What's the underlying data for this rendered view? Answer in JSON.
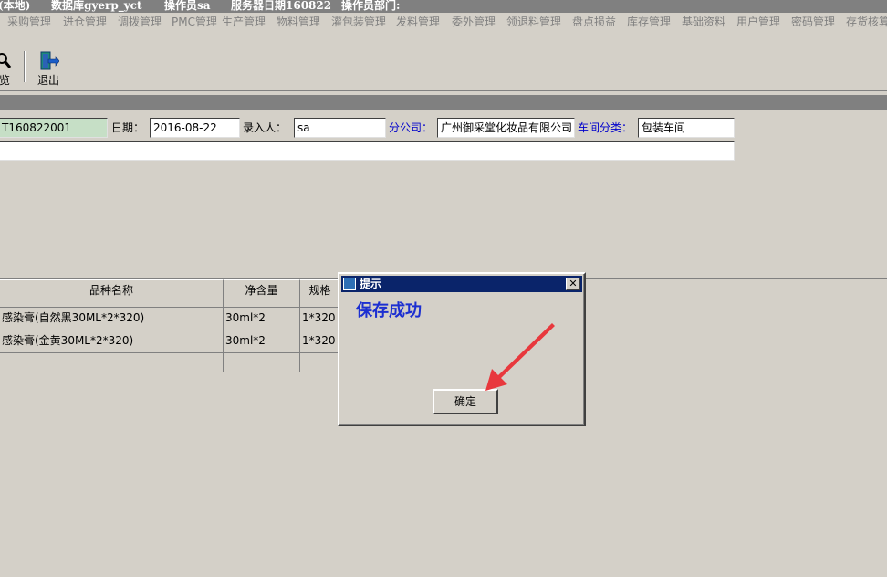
{
  "status": {
    "location": "(本地)",
    "database": "数据库gyerp_yct",
    "operator": "操作员sa",
    "server_date": "服务器日期160822",
    "department": "操作员部门:"
  },
  "menu": [
    "采购管理",
    "进仓管理",
    "调拨管理",
    "PMC管理",
    "生产管理",
    "物料管理",
    "灌包装管理",
    "发料管理",
    "委外管理",
    "领退料管理",
    "盘点损益",
    "库存管理",
    "基础资料",
    "用户管理",
    "密码管理",
    "存货核算"
  ],
  "toolbar": {
    "preview_label": "览",
    "exit_label": "退出"
  },
  "form": {
    "doc_no": "T160822001",
    "date_label": "日期：",
    "date_value": "2016-08-22",
    "entry_label": "录入人：",
    "entry_value": "sa",
    "branch_label": "分公司：",
    "branch_value": "广州御采堂化妆品有限公司",
    "workshop_label": "车间分类：",
    "workshop_value": "包装车间",
    "remark_value": ""
  },
  "grid": {
    "headers": [
      "品种名称",
      "净含量",
      "规格"
    ],
    "rows": [
      [
        "感染膏(自然黑30ML*2*320)",
        "30ml*2",
        "1*320"
      ],
      [
        "感染膏(金黄30ML*2*320)",
        "30ml*2",
        "1*320"
      ],
      [
        "",
        "",
        ""
      ]
    ]
  },
  "dialog": {
    "title": "提示",
    "close": "✕",
    "message": "保存成功",
    "ok_label": "确定",
    "annotation_color": "#e8383d"
  }
}
